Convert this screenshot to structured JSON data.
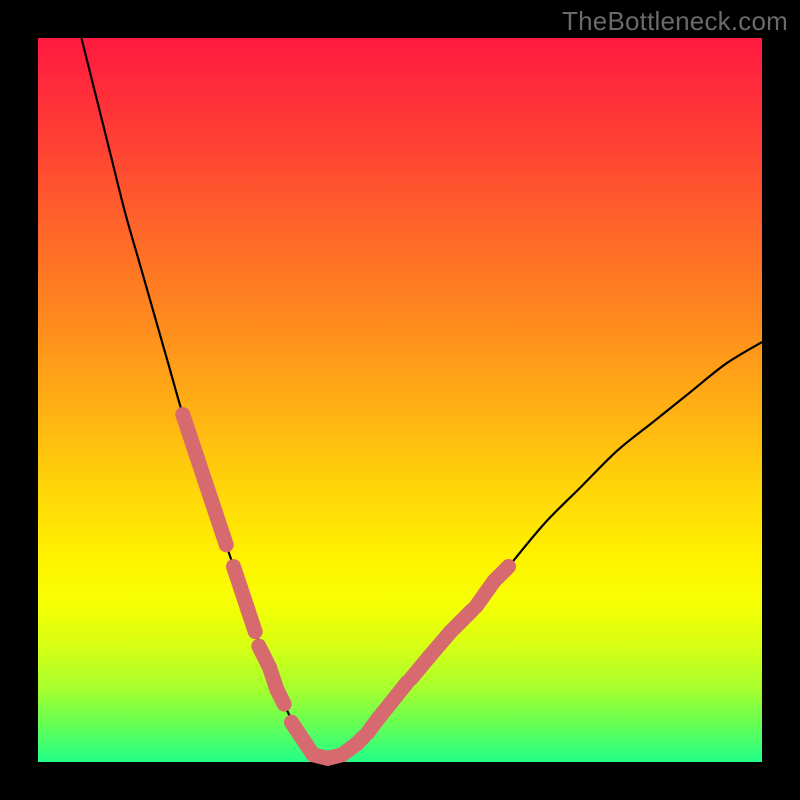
{
  "watermark": "TheBottleneck.com",
  "colors": {
    "frame": "#000000",
    "gradient_top": "#ff193f",
    "gradient_bottom": "#22ff88",
    "curve": "#000000",
    "marker": "#d76a6f"
  },
  "chart_data": {
    "type": "line",
    "title": "",
    "xlabel": "",
    "ylabel": "",
    "xlim": [
      0,
      100
    ],
    "ylim": [
      0,
      100
    ],
    "series": [
      {
        "name": "bottleneck-curve",
        "x": [
          6,
          8,
          10,
          12,
          14,
          16,
          18,
          20,
          22,
          24,
          26,
          28,
          30,
          32,
          34,
          36,
          38,
          42,
          46,
          50,
          55,
          60,
          65,
          70,
          75,
          80,
          85,
          90,
          95,
          100
        ],
        "y": [
          100,
          92,
          84,
          76,
          69,
          62,
          55,
          48,
          42,
          36,
          30,
          24,
          18,
          13,
          8,
          4,
          1,
          1,
          4,
          9,
          15,
          21,
          27,
          33,
          38,
          43,
          47,
          51,
          55,
          58
        ]
      }
    ],
    "markers": {
      "name": "highlighted-segments",
      "segments": [
        {
          "x": [
            20,
            22,
            24,
            26
          ],
          "y": [
            48,
            42,
            36,
            30
          ]
        },
        {
          "x": [
            27,
            28,
            29,
            30
          ],
          "y": [
            27,
            24,
            21,
            18
          ]
        },
        {
          "x": [
            30.5,
            32,
            33,
            34
          ],
          "y": [
            16,
            13,
            10,
            8
          ]
        },
        {
          "x": [
            35,
            36,
            37,
            38,
            40,
            42,
            44,
            45
          ],
          "y": [
            5.5,
            4,
            2.5,
            1,
            0.5,
            1,
            2.5,
            3.5
          ]
        },
        {
          "x": [
            45.5,
            47,
            49,
            51
          ],
          "y": [
            4,
            6,
            8.5,
            11
          ]
        },
        {
          "x": [
            51.5,
            54,
            57,
            60
          ],
          "y": [
            11.5,
            14.5,
            18,
            21
          ]
        },
        {
          "x": [
            60.5,
            63,
            65
          ],
          "y": [
            21.5,
            25,
            27
          ]
        }
      ]
    }
  }
}
